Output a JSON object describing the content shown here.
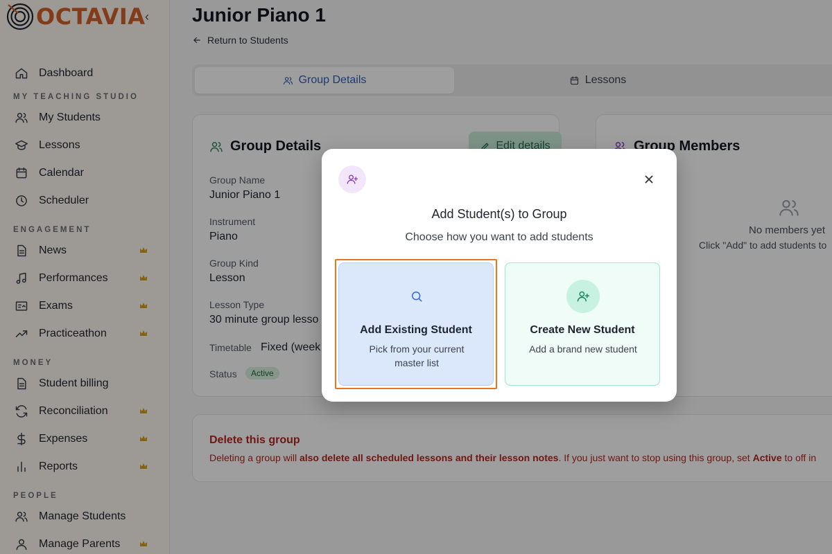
{
  "app": {
    "logo_text": "OCTAVIA"
  },
  "sidebar": {
    "top_item": {
      "label": "Dashboard",
      "icon": "home-icon"
    },
    "sections": [
      {
        "title": "MY TEACHING STUDIO",
        "items": [
          {
            "label": "My Students",
            "icon": "users-icon",
            "premium": false
          },
          {
            "label": "Lessons",
            "icon": "graduation-cap-icon",
            "premium": false
          },
          {
            "label": "Calendar",
            "icon": "calendar-icon",
            "premium": false
          },
          {
            "label": "Scheduler",
            "icon": "clock-icon",
            "premium": false
          }
        ]
      },
      {
        "title": "ENGAGEMENT",
        "items": [
          {
            "label": "News",
            "icon": "document-icon",
            "premium": true
          },
          {
            "label": "Performances",
            "icon": "music-note-icon",
            "premium": true
          },
          {
            "label": "Exams",
            "icon": "certificate-icon",
            "premium": true
          },
          {
            "label": "Practiceathon",
            "icon": "trend-icon",
            "premium": true
          }
        ]
      },
      {
        "title": "MONEY",
        "items": [
          {
            "label": "Student billing",
            "icon": "document-icon",
            "premium": false
          },
          {
            "label": "Reconciliation",
            "icon": "refresh-icon",
            "premium": true
          },
          {
            "label": "Expenses",
            "icon": "dollar-icon",
            "premium": true
          },
          {
            "label": "Reports",
            "icon": "bar-chart-icon",
            "premium": true
          }
        ]
      },
      {
        "title": "PEOPLE",
        "items": [
          {
            "label": "Manage Students",
            "icon": "users-icon",
            "premium": false
          },
          {
            "label": "Manage Parents",
            "icon": "user-icon",
            "premium": true
          }
        ]
      }
    ],
    "colors": {
      "crown": "#d4a017",
      "brand": "#d2612a"
    }
  },
  "page": {
    "title": "Junior Piano 1",
    "back_label": "Return to Students",
    "tabs": [
      {
        "label": "Group Details",
        "active": true
      },
      {
        "label": "Lessons",
        "active": false
      }
    ]
  },
  "details": {
    "title": "Group Details",
    "edit_label": "Edit details",
    "fields": [
      {
        "label": "Group Name",
        "value": "Junior Piano 1"
      },
      {
        "label": "Instrument",
        "value": "Piano"
      },
      {
        "label": "Group Kind",
        "value": "Lesson"
      },
      {
        "label": "Lesson Type",
        "value": "30 minute group lesso"
      }
    ],
    "timetable_label": "Timetable",
    "timetable_value": "Fixed (week",
    "status_label": "Status",
    "status_value": "Active"
  },
  "members": {
    "title": "Group Members",
    "empty_title": "No members yet",
    "empty_sub": "Click \"Add\" to add students to"
  },
  "danger": {
    "title": "Delete this group",
    "text_1": "Deleting a group will ",
    "text_bold_1": "also delete all scheduled lessons and their lesson notes",
    "text_2": ". If you just want to stop using this group, set ",
    "text_bold_2": "Active",
    "text_3": " to off in"
  },
  "modal": {
    "title": "Add Student(s) to Group",
    "subtitle": "Choose how you want to add students",
    "options": [
      {
        "title": "Add Existing Student",
        "desc": "Pick from your current master list",
        "icon": "search-icon"
      },
      {
        "title": "Create New Student",
        "desc": "Add a brand new student",
        "icon": "user-plus-icon"
      }
    ]
  }
}
